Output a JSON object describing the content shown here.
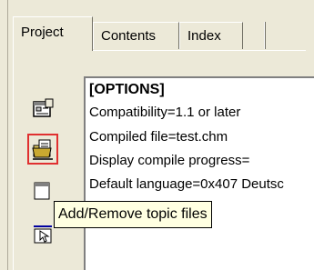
{
  "tabs": [
    {
      "label": "Project",
      "active": true
    },
    {
      "label": "Contents",
      "active": false
    },
    {
      "label": "Index",
      "active": false
    }
  ],
  "toolbar": {
    "buttons": [
      {
        "icon": "change-options-icon"
      },
      {
        "icon": "add-remove-files-icon",
        "highlighted": true,
        "highlight_color": "#e03030"
      },
      {
        "icon": "add-remove-topics-icon"
      },
      {
        "icon": "view-html-source-icon"
      }
    ]
  },
  "project_listing": {
    "lines": [
      "[OPTIONS]",
      "Compatibility=1.1 or later",
      "Compiled file=test.chm",
      "Display compile progress=",
      "Default language=0x407 Deutsc"
    ]
  },
  "tooltip": {
    "text": "Add/Remove topic files",
    "background": "#ffffe1"
  }
}
